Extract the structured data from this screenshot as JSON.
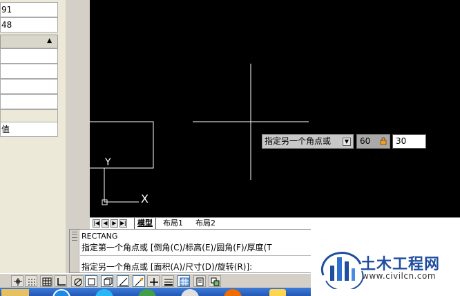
{
  "palette": {
    "rows": [
      "91",
      "48"
    ],
    "collapse_icon": "triangle-up-icon",
    "last_row": "值"
  },
  "canvas": {
    "ucs_y": "Y",
    "ucs_x": "X"
  },
  "dynamic_input": {
    "prompt": "指定另一个角点或",
    "dropdown_icon": "dropdown-arrow-icon",
    "x_value": "60",
    "y_value": "30",
    "lock_icon": "lock-icon"
  },
  "layout_tabs": {
    "model": "模型",
    "layout1": "布局1",
    "layout2": "布局2"
  },
  "command": {
    "line1": "RECTANG",
    "line2": "指定第一个角点或 [倒角(C)/标高(E)/圆角(F)/厚度(T",
    "line3": "指定另一个角点或 [面积(A)/尺寸(D)/旋转(R)]:"
  },
  "watermark": {
    "title": "土木工程网",
    "url": "www.civilcn.com"
  },
  "colors": {
    "canvas_bg": "#000000",
    "drawing_lines": "#ffffff",
    "logo_blue": "#1f4e9e"
  }
}
